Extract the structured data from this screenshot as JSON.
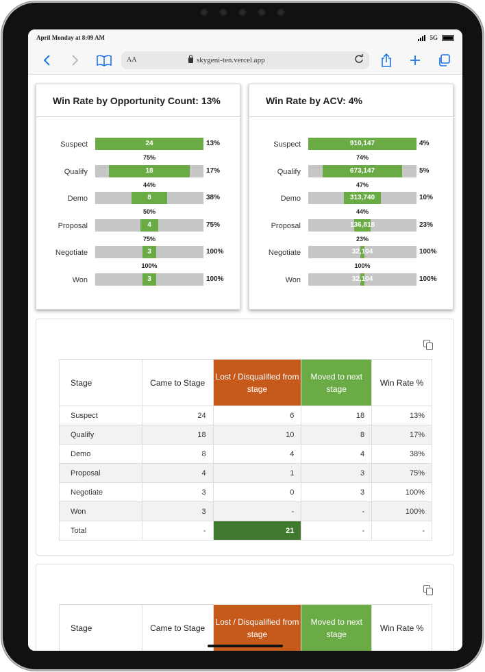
{
  "status": {
    "time": "April Monday at 8:09 AM",
    "network": "5G"
  },
  "browser": {
    "aa_label": "AA",
    "url": "skygeni-ten.vercel.app"
  },
  "funnel_count": {
    "title": "Win Rate by Opportunity Count: 13%",
    "stages": [
      {
        "label": "Suspect",
        "value": "24",
        "fraction": 1.0,
        "rate": "13%"
      },
      {
        "label": "Qualify",
        "value": "18",
        "fraction": 0.75,
        "rate": "17%"
      },
      {
        "label": "Demo",
        "value": "8",
        "fraction": 0.333,
        "rate": "38%"
      },
      {
        "label": "Proposal",
        "value": "4",
        "fraction": 0.167,
        "rate": "75%"
      },
      {
        "label": "Negotiate",
        "value": "3",
        "fraction": 0.125,
        "rate": "100%"
      },
      {
        "label": "Won",
        "value": "3",
        "fraction": 0.125,
        "rate": "100%"
      }
    ],
    "conversions": [
      "75%",
      "44%",
      "50%",
      "75%",
      "100%"
    ]
  },
  "funnel_acv": {
    "title": "Win Rate by ACV: 4%",
    "stages": [
      {
        "label": "Suspect",
        "value": "910,147",
        "fraction": 1.0,
        "rate": "4%"
      },
      {
        "label": "Qualify",
        "value": "673,147",
        "fraction": 0.74,
        "rate": "5%"
      },
      {
        "label": "Demo",
        "value": "313,740",
        "fraction": 0.345,
        "rate": "10%"
      },
      {
        "label": "Proposal",
        "value": "136,818",
        "fraction": 0.15,
        "rate": "23%"
      },
      {
        "label": "Negotiate",
        "value": "32,104",
        "fraction": 0.035,
        "rate": "100%"
      },
      {
        "label": "Won",
        "value": "32,104",
        "fraction": 0.035,
        "rate": "100%"
      }
    ],
    "conversions": [
      "74%",
      "47%",
      "44%",
      "23%",
      "100%"
    ]
  },
  "table": {
    "headers": {
      "stage": "Stage",
      "came": "Came to Stage",
      "lost": "Lost / Disqualified from stage",
      "moved": "Moved to next stage",
      "win": "Win Rate %"
    },
    "rows": [
      {
        "stage": "Suspect",
        "came": "24",
        "lost": "6",
        "moved": "18",
        "win": "13%"
      },
      {
        "stage": "Qualify",
        "came": "18",
        "lost": "10",
        "moved": "8",
        "win": "17%"
      },
      {
        "stage": "Demo",
        "came": "8",
        "lost": "4",
        "moved": "4",
        "win": "38%"
      },
      {
        "stage": "Proposal",
        "came": "4",
        "lost": "1",
        "moved": "3",
        "win": "75%"
      },
      {
        "stage": "Negotiate",
        "came": "3",
        "lost": "0",
        "moved": "3",
        "win": "100%"
      },
      {
        "stage": "Won",
        "came": "3",
        "lost": "-",
        "moved": "-",
        "win": "100%"
      }
    ],
    "total": {
      "stage": "Total",
      "came": "-",
      "lost": "21",
      "moved": "-",
      "win": "-"
    }
  },
  "colors": {
    "funnel_green": "#6aab46",
    "lost_orange": "#c55a1a",
    "total_green": "#3f7a2e",
    "track_gray": "#c6c6c6"
  },
  "icons": [
    "back-icon",
    "forward-icon",
    "bookmarks-icon",
    "lock-icon",
    "reload-icon",
    "share-icon",
    "new-tab-icon",
    "tabs-icon",
    "copy-icon"
  ]
}
